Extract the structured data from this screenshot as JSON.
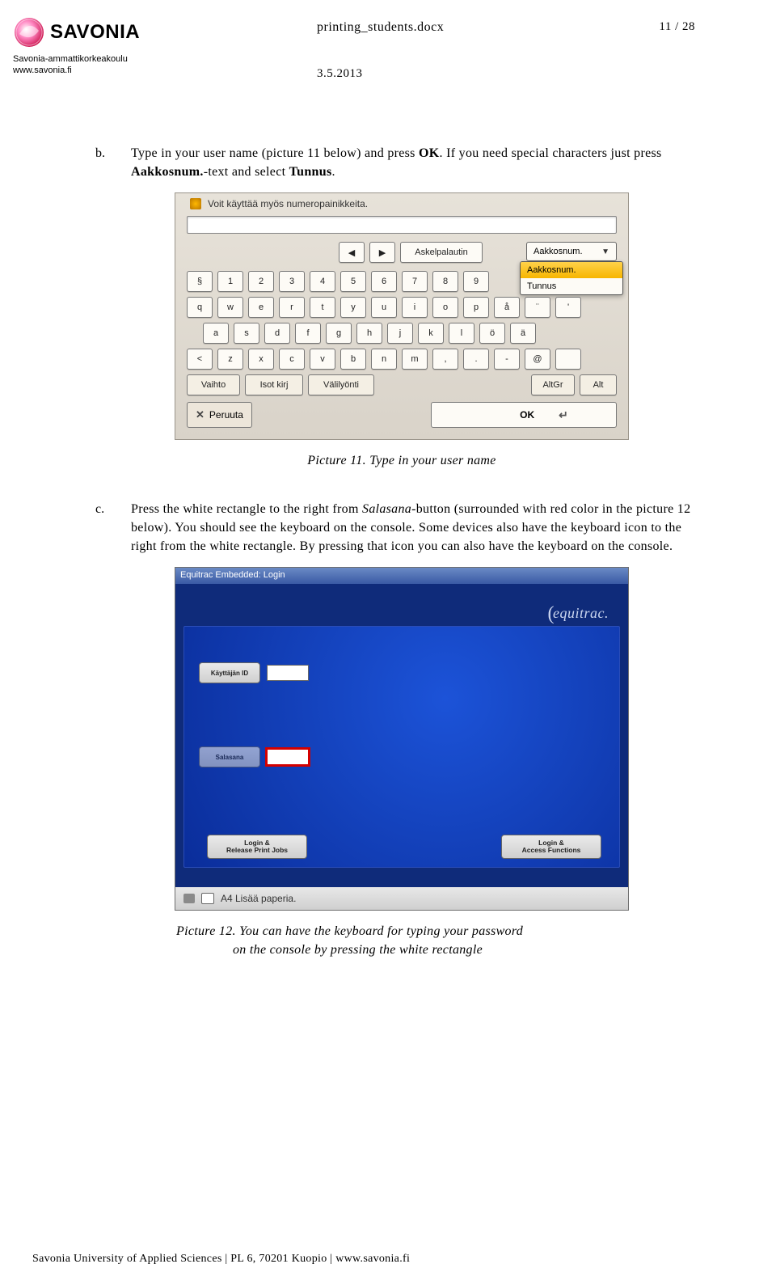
{
  "header": {
    "filename": "printing_students.docx",
    "page": "11 / 28",
    "date": "3.5.2013",
    "org_name": "SAVONIA",
    "org_sub": "Savonia-ammattikorkeakoulu",
    "org_url": "www.savonia.fi"
  },
  "body": {
    "b_marker": "b.",
    "b_text_1": "Type in your user name (picture 11 below) and press ",
    "b_ok": "OK",
    "b_text_2": ". If you need special characters just press ",
    "b_aak": "Aakkosnum.",
    "b_text_3": "-text and select ",
    "b_tunnus": "Tunnus",
    "b_period": ".",
    "caption11": "Picture 11. Type in your user name",
    "c_marker": "c.",
    "c_text_1": "Press the white rectangle to the right from ",
    "c_salasana": "Salasana",
    "c_text_2": "-button (surrounded with red color in the picture 12 below). You should see the keyboard on the console. Some devices also have the keyboard icon to the right from the white rectangle. By pressing that icon you can also have the keyboard on the console.",
    "caption12a": "Picture 12. You can have the keyboard for typing your password",
    "caption12b": "on the console by pressing the white rectangle"
  },
  "pic11": {
    "info": "Voit käyttää myös numeropainikkeita.",
    "arrow_left": "◀",
    "arrow_right": "▶",
    "askelpalautin": "Askelpalautin",
    "dd_label": "Aakkosnum.",
    "dd_opt1": "Aakkosnum.",
    "dd_opt2": "Tunnus",
    "row_num": [
      "§",
      "1",
      "2",
      "3",
      "4",
      "5",
      "6",
      "7",
      "8",
      "9"
    ],
    "row_q": [
      "q",
      "w",
      "e",
      "r",
      "t",
      "y",
      "u",
      "i",
      "o",
      "p",
      "å",
      "¨",
      "'"
    ],
    "row_a": [
      "a",
      "s",
      "d",
      "f",
      "g",
      "h",
      "j",
      "k",
      "l",
      "ö",
      "ä"
    ],
    "row_z": [
      "<",
      "z",
      "x",
      "c",
      "v",
      "b",
      "n",
      "m",
      ",",
      ".",
      "-",
      "@",
      ""
    ],
    "fn": {
      "vaihto": "Vaihto",
      "isot": "Isot kirj",
      "vali": "Välilyönti",
      "altgr": "AltGr",
      "alt": "Alt"
    },
    "cancel": "Peruuta",
    "ok": "OK",
    "chev": "▼"
  },
  "pic12": {
    "title": "Equitrac Embedded: Login",
    "brand": "equitrac.",
    "uid": "Käyttäjän ID",
    "pwd": "Salasana",
    "login_release": "Login &\nRelease Print Jobs",
    "login_access": "Login &\nAccess Functions",
    "status": "A4  Lisää paperia."
  },
  "footer": "Savonia University of Applied Sciences | PL 6, 70201 Kuopio | www.savonia.fi"
}
